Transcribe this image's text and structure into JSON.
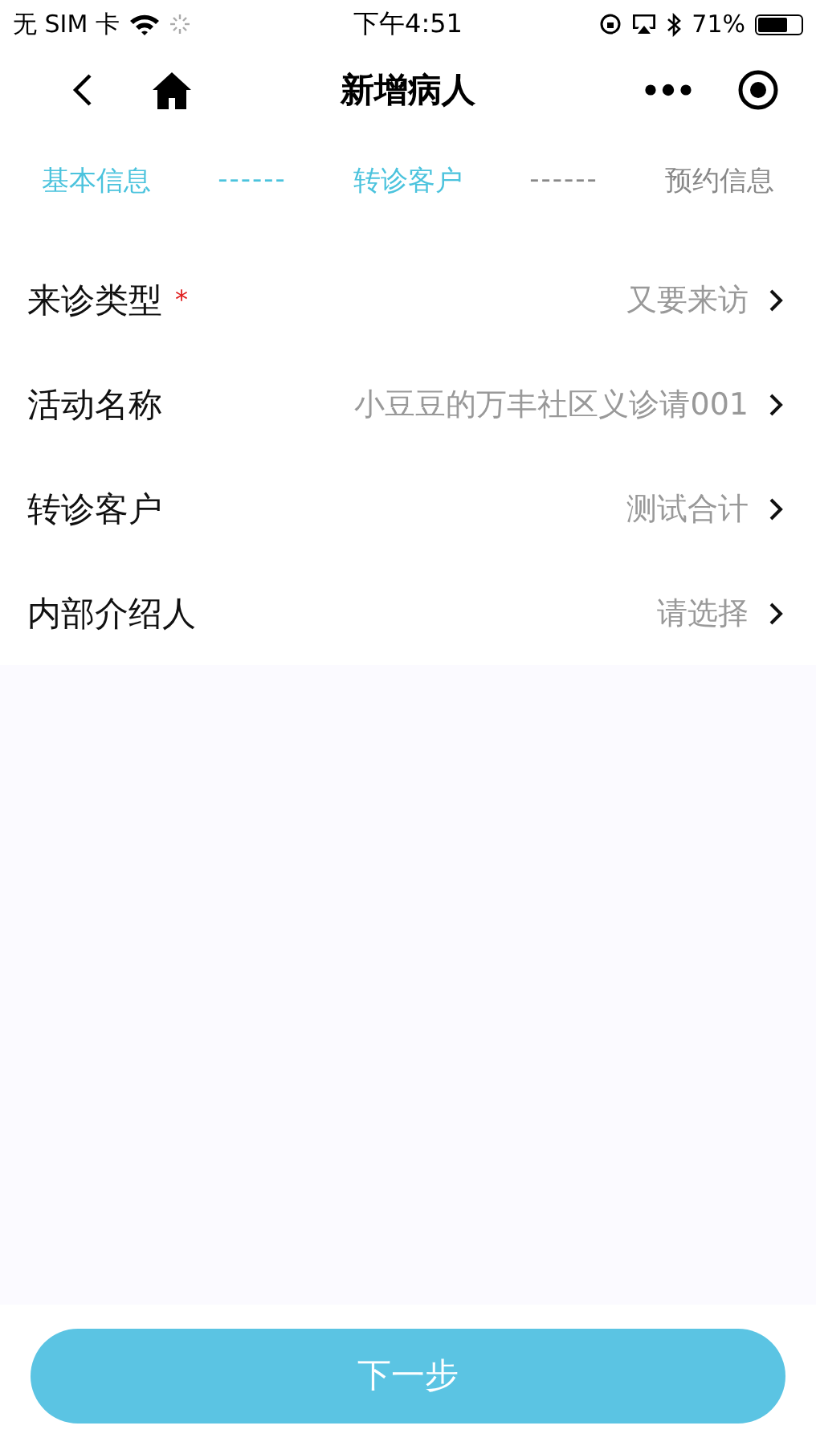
{
  "status_bar": {
    "carrier": "无 SIM 卡",
    "time": "下午4:51",
    "battery": "71%"
  },
  "nav": {
    "title": "新增病人"
  },
  "steps": [
    {
      "kind": "step",
      "label": "基本信息",
      "active": true
    },
    {
      "kind": "connector",
      "label": "------",
      "active": true
    },
    {
      "kind": "step",
      "label": "转诊客户",
      "active": true
    },
    {
      "kind": "connector",
      "label": "------",
      "active": false
    },
    {
      "kind": "step",
      "label": "预约信息",
      "active": false
    }
  ],
  "form_rows": [
    {
      "label": "来诊类型",
      "required_mark": "*",
      "value": "又要来访"
    },
    {
      "label": "活动名称",
      "value": "小豆豆的万丰社区义诊请001"
    },
    {
      "label": "转诊客户",
      "value": "测试合计"
    },
    {
      "label": "内部介绍人",
      "value": "请选择"
    }
  ],
  "next_button": {
    "label": "下一步"
  }
}
